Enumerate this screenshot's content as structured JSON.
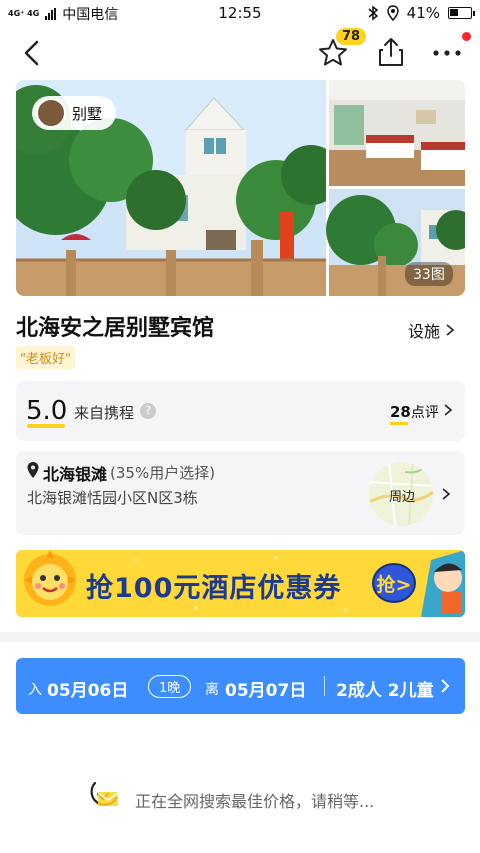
{
  "status": {
    "network_label": "4G⁺ 4G",
    "carrier": "中国电信",
    "time": "12:55",
    "battery": "41%",
    "battery_level": 0.41
  },
  "nav": {
    "favorite_count": "78"
  },
  "gallery": {
    "tag_label": "别墅",
    "photo_count": "33图"
  },
  "hotel": {
    "name": "北海安之居别墅宾馆",
    "facilities_label": "设施",
    "tagline": "\"老板好\""
  },
  "rating": {
    "score": "5.0",
    "source": "来自携程",
    "help": "?",
    "review_count": "28",
    "review_unit": "点评"
  },
  "location": {
    "area": "北海银滩",
    "share": "(35%用户选择)",
    "address": "北海银滩恬园小区N区3栋",
    "map_label": "周边"
  },
  "banner": {
    "text": "抢100元酒店优惠券",
    "button": "抢>"
  },
  "booking": {
    "checkin_prefix": "入",
    "checkin": "05月06日",
    "nights": "1晚",
    "checkout_prefix": "离",
    "checkout": "05月07日",
    "guests": "2成人 2儿童"
  },
  "loading": {
    "text": "正在全网搜索最佳价格，请稍等..."
  },
  "colors": {
    "accent_yellow": "#ffd21e",
    "date_bar_blue": "#3e8dff",
    "banner_blue": "#1d3b8a"
  }
}
